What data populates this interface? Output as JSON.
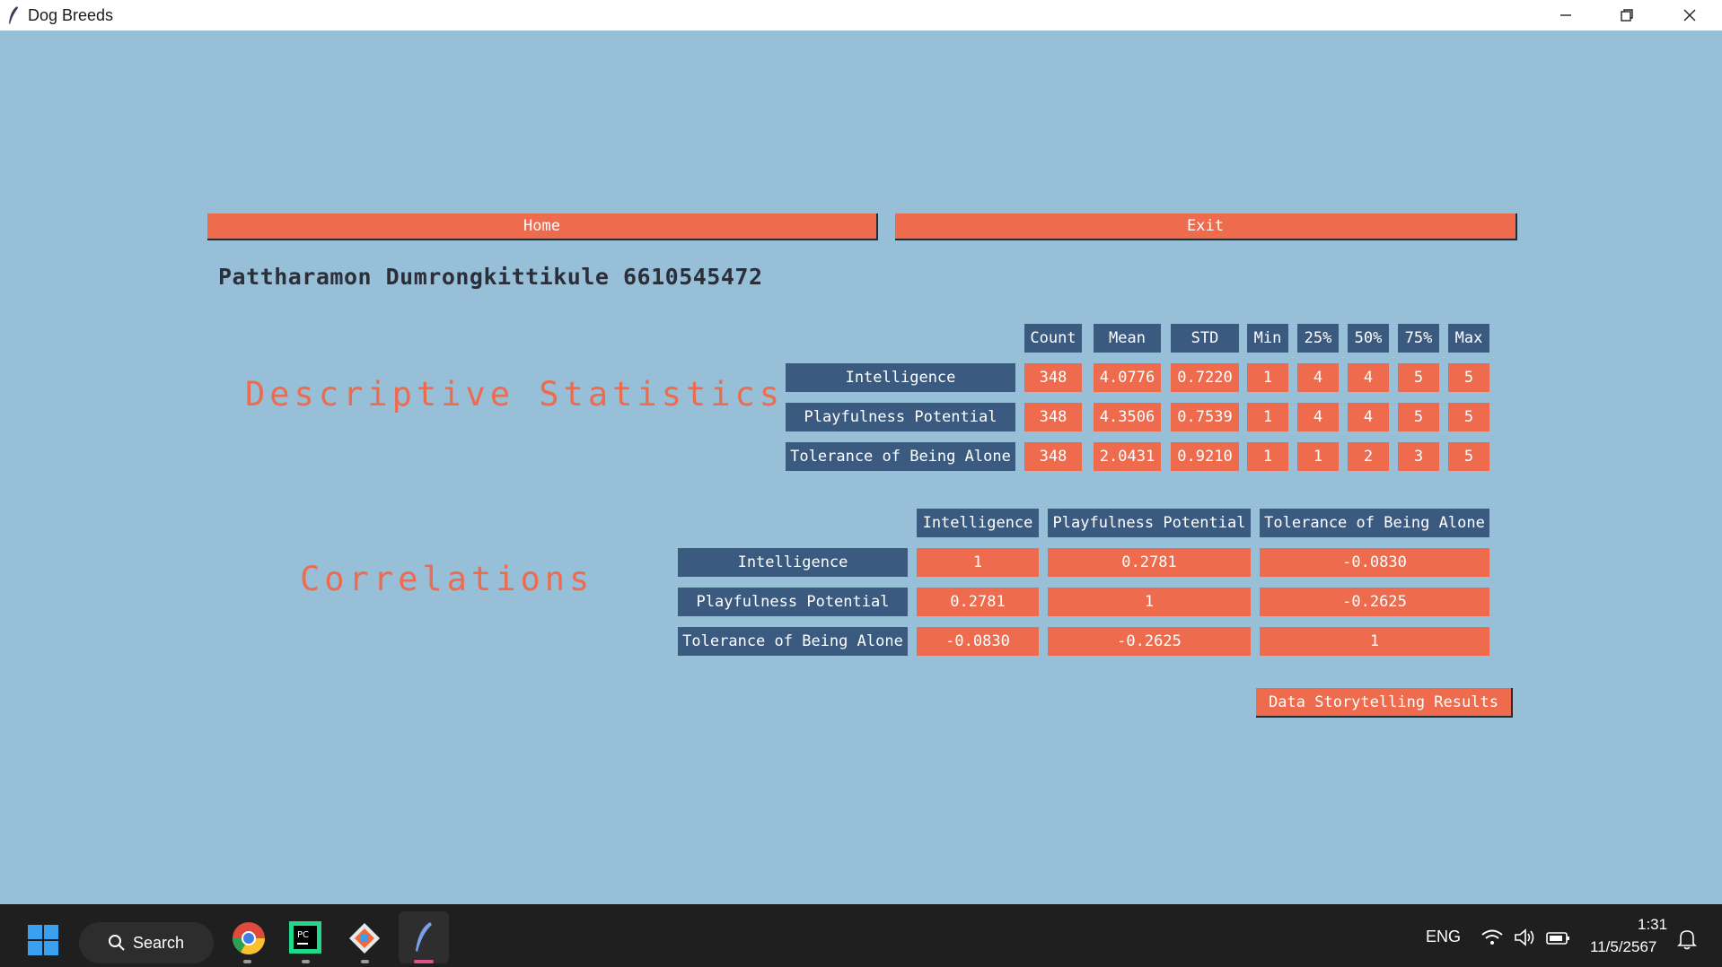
{
  "window": {
    "title": "Dog Breeds"
  },
  "nav": {
    "home_label": "Home",
    "exit_label": "Exit"
  },
  "author": "Pattharamon Dumrongkittikule 6610545472",
  "descriptive": {
    "title": "Descriptive Statistics",
    "columns": [
      "Count",
      "Mean",
      "STD",
      "Min",
      "25%",
      "50%",
      "75%",
      "Max"
    ],
    "rows": [
      {
        "label": "Intelligence",
        "values": [
          "348",
          "4.0776",
          "0.7220",
          "1",
          "4",
          "4",
          "5",
          "5"
        ]
      },
      {
        "label": "Playfulness Potential",
        "values": [
          "348",
          "4.3506",
          "0.7539",
          "1",
          "4",
          "4",
          "5",
          "5"
        ]
      },
      {
        "label": "Tolerance of Being Alone",
        "values": [
          "348",
          "2.0431",
          "0.9210",
          "1",
          "1",
          "2",
          "3",
          "5"
        ]
      }
    ]
  },
  "correlations": {
    "title": "Correlations",
    "columns": [
      "Intelligence",
      "Playfulness Potential",
      "Tolerance of Being Alone"
    ],
    "rows": [
      {
        "label": "Intelligence",
        "values": [
          "1",
          "0.2781",
          "-0.0830"
        ]
      },
      {
        "label": "Playfulness Potential",
        "values": [
          "0.2781",
          "1",
          "-0.2625"
        ]
      },
      {
        "label": "Tolerance of Being Alone",
        "values": [
          "-0.0830",
          "-0.2625",
          "1"
        ]
      }
    ]
  },
  "storytelling_button": "Data Storytelling Results",
  "taskbar": {
    "search_label": "Search",
    "language": "ENG",
    "time": "1:31",
    "date": "11/5/2567"
  },
  "colors": {
    "background": "#98bfd8",
    "accent": "#ee6b4d",
    "header": "#3a5a80"
  }
}
